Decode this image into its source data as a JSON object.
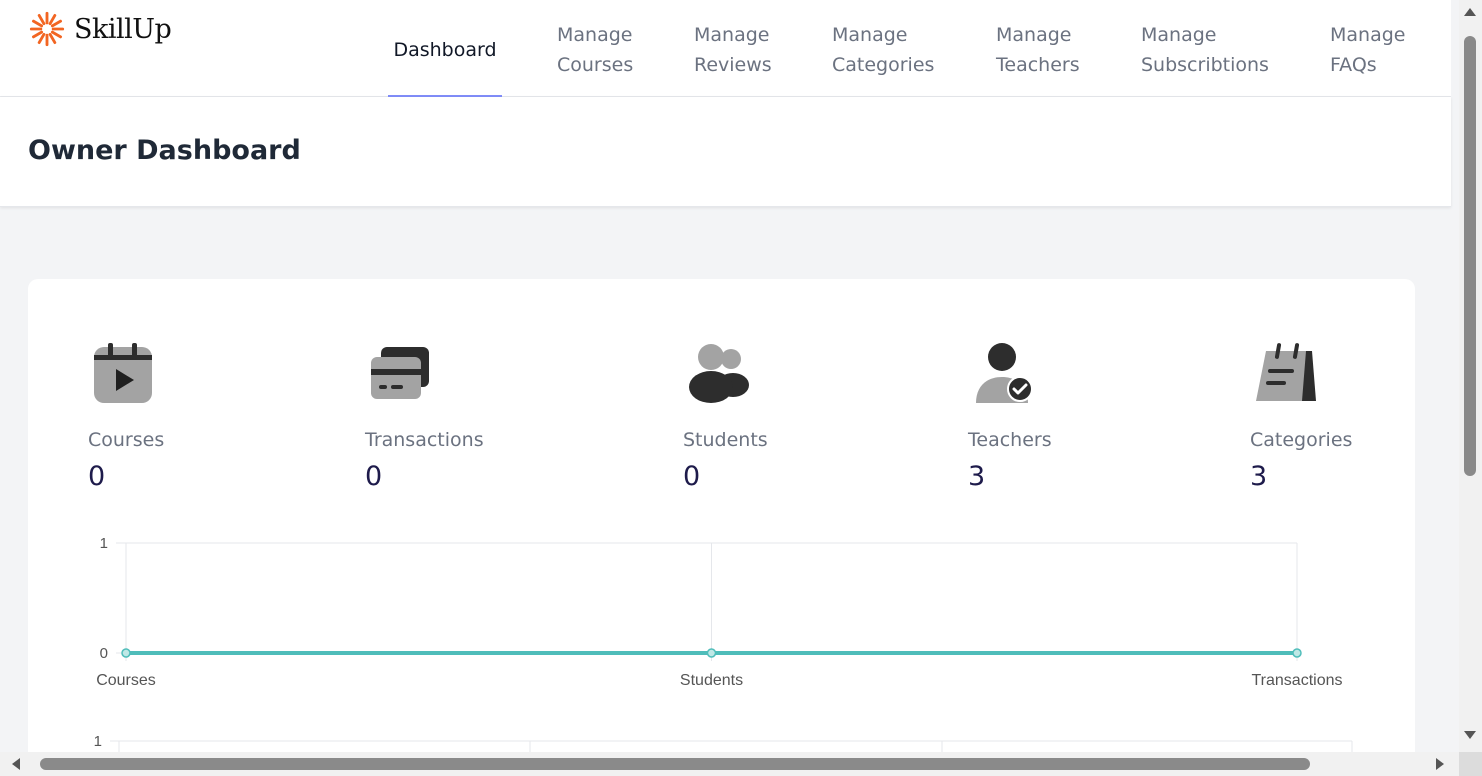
{
  "brand": {
    "name": "SkillUp",
    "logo_icon": "sunburst-logo-icon",
    "logo_color": "#f26522"
  },
  "nav": {
    "items": [
      {
        "label": "Dashboard",
        "active": true
      },
      {
        "label": "Manage\nCourses",
        "line1": "Manage",
        "line2": "Courses"
      },
      {
        "label": "Manage\nReviews",
        "line1": "Manage",
        "line2": "Reviews"
      },
      {
        "label": "Manage\nCategories",
        "line1": "Manage",
        "line2": "Categories"
      },
      {
        "label": "Manage\nTeachers",
        "line1": "Manage",
        "line2": "Teachers"
      },
      {
        "label": "Manage\nSubscribtions",
        "line1": "Manage",
        "line2": "Subscribtions"
      },
      {
        "label": "Manage\nFAQs",
        "line1": "Manage",
        "line2": "FAQs"
      }
    ],
    "active_color": "#818cf8"
  },
  "page": {
    "title": "Owner Dashboard"
  },
  "stats": [
    {
      "label": "Courses",
      "value": "0",
      "icon": "video-calendar-icon"
    },
    {
      "label": "Transactions",
      "value": "0",
      "icon": "credit-cards-icon"
    },
    {
      "label": "Students",
      "value": "0",
      "icon": "users-group-icon"
    },
    {
      "label": "Teachers",
      "value": "3",
      "icon": "user-check-icon"
    },
    {
      "label": "Categories",
      "value": "3",
      "icon": "notepad-icon"
    }
  ],
  "chart_data": [
    {
      "type": "line",
      "categories": [
        "Courses",
        "Students",
        "Transactions"
      ],
      "series": [
        {
          "values": [
            0,
            0,
            0
          ],
          "color": "#4fbdba"
        }
      ],
      "ylim": [
        0,
        1
      ],
      "yticks": [
        "0",
        "1"
      ],
      "grid": true
    },
    {
      "type": "line",
      "categories": [],
      "series": [],
      "ylim": [
        0,
        1
      ],
      "yticks": [
        "1"
      ],
      "grid": true
    }
  ]
}
